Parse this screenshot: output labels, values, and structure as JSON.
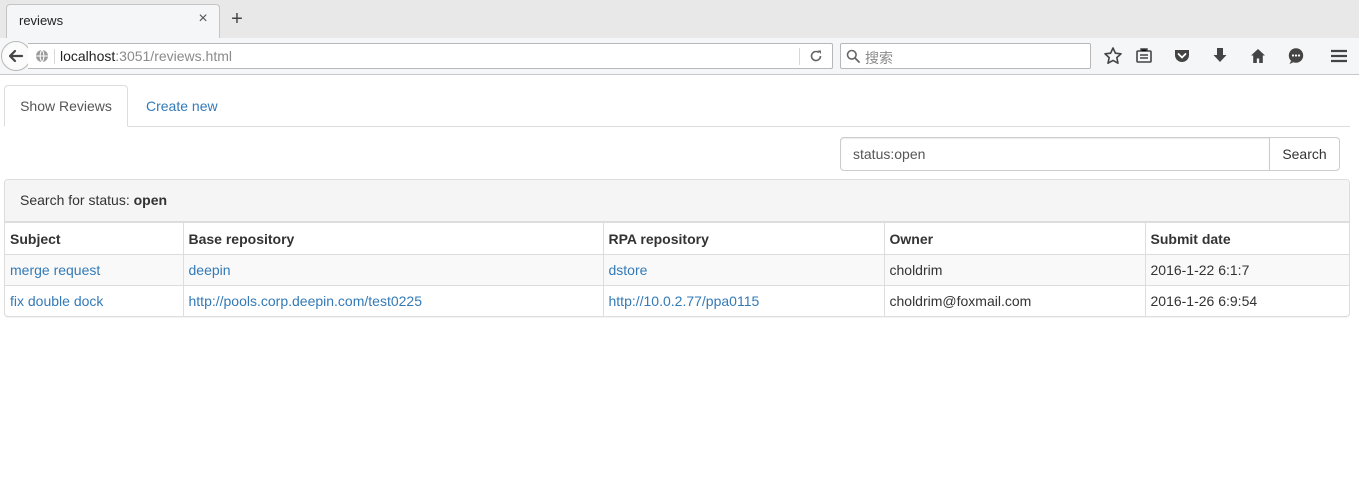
{
  "browser": {
    "tab_title": "reviews",
    "tab_close": "×",
    "new_tab": "+",
    "url_host": "localhost",
    "url_rest": ":3051/reviews.html",
    "search_placeholder": "搜索"
  },
  "nav": {
    "tabs": [
      {
        "label": "Show Reviews",
        "active": true
      },
      {
        "label": "Create new",
        "active": false
      }
    ]
  },
  "search": {
    "value": "status:open",
    "button_label": "Search"
  },
  "results": {
    "heading_prefix": "Search for status:",
    "heading_value": "open",
    "columns": [
      "Subject",
      "Base repository",
      "RPA repository",
      "Owner",
      "Submit date"
    ],
    "rows": [
      {
        "subject": "merge request",
        "base_repo": "deepin",
        "rpa_repo": "dstore",
        "owner": "choldrim",
        "submit_date": "2016-1-22 6:1:7"
      },
      {
        "subject": "fix double dock",
        "base_repo": "http://pools.corp.deepin.com/test0225",
        "rpa_repo": "http://10.0.2.77/ppa0115",
        "owner": "choldrim@foxmail.com",
        "submit_date": "2016-1-26 6:9:54"
      }
    ]
  },
  "icons": {
    "toolbar": [
      "bookmark-star-icon",
      "reading-list-icon",
      "pocket-icon",
      "downloads-icon",
      "home-icon",
      "chat-icon",
      "menu-icon"
    ]
  },
  "colors": {
    "link": "#337ab7",
    "panel_heading_bg": "#f5f5f5",
    "border": "#dddddd"
  }
}
